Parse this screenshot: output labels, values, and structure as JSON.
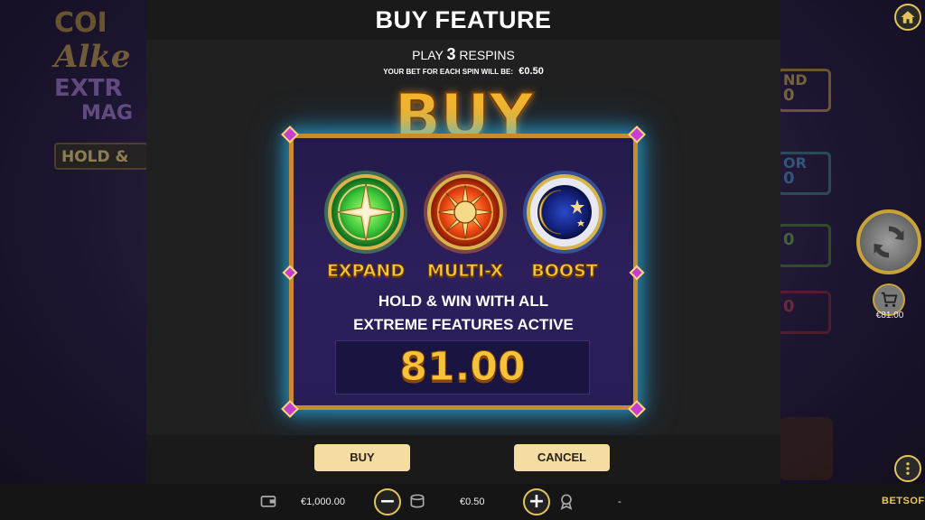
{
  "modal": {
    "title": "BUY FEATURE",
    "play_prefix": "PLAY",
    "play_count": "3",
    "play_suffix": "RESPINS",
    "bet_label": "YOUR BET FOR EACH SPIN WILL BE:",
    "bet_amount": "€0.50",
    "buy_heading": "BUY",
    "features": [
      {
        "label": "EXPAND",
        "icon": "compass-icon",
        "color": "#2fb83a"
      },
      {
        "label": "MULTI-X",
        "icon": "sun-icon",
        "color": "#e24a14"
      },
      {
        "label": "BOOST",
        "icon": "moon-stars-icon",
        "color": "#2f6be0"
      }
    ],
    "description_line1": "HOLD & WIN WITH ALL",
    "description_line2": "EXTREME FEATURES ACTIVE",
    "price": "81.00",
    "buy_button": "BUY",
    "cancel_button": "CANCEL"
  },
  "background": {
    "logo_lines": [
      "COI",
      "Alke",
      "EXTR",
      "MAG"
    ],
    "hold_badge": "HOLD &",
    "jackpots": [
      "ND",
      "0",
      "OR",
      "0",
      "",
      "0",
      "",
      "0"
    ]
  },
  "side": {
    "buy_feature_price": "€81.00"
  },
  "bottom_bar": {
    "balance": "€1,000.00",
    "bet": "€0.50",
    "win": "-",
    "brand": "BETSOFT"
  },
  "colors": {
    "accent_gold": "#f5b52a",
    "button_bg": "#f3dda2",
    "panel_glow": "#28c8ff"
  }
}
